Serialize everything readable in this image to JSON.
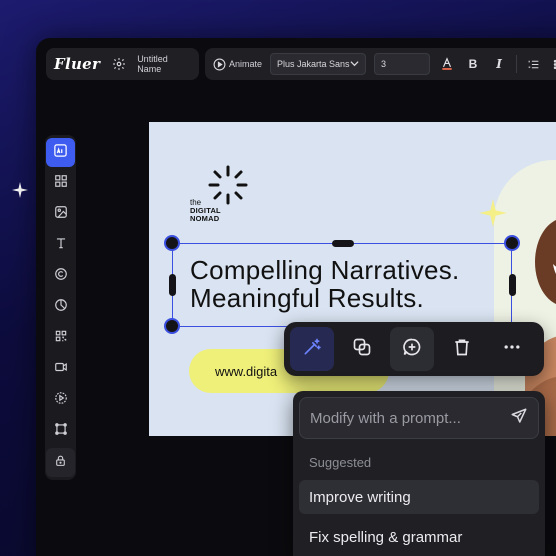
{
  "app": {
    "logo": "Fluer",
    "document_name": "Untitled Name",
    "animate_label": "Animate",
    "font_family": "Plus Jakarta Sans",
    "font_size": "3"
  },
  "toolbar_buttons": {
    "bold": "B",
    "italic": "I"
  },
  "sidebar": {
    "items": [
      {
        "icon": "ai-image-icon"
      },
      {
        "icon": "grid-icon"
      },
      {
        "icon": "image-icon"
      },
      {
        "icon": "text-icon"
      },
      {
        "icon": "copyright-icon"
      },
      {
        "icon": "chart-icon"
      },
      {
        "icon": "qr-code-icon"
      },
      {
        "icon": "video-icon"
      },
      {
        "icon": "audio-icon"
      },
      {
        "icon": "resize-icon"
      },
      {
        "icon": "lock-icon"
      }
    ]
  },
  "canvas": {
    "brand_the": "the",
    "brand_line1": "DIGITAL",
    "brand_line2": "NOMAD",
    "headline_line1": "Compelling Narratives.",
    "headline_line2": "Meaningful Results.",
    "url_text": "www.digita"
  },
  "floating_toolbar": {
    "buttons": [
      "magic-edit-icon",
      "duplicate-icon",
      "add-comment-icon",
      "delete-icon",
      "more-icon"
    ]
  },
  "prompt": {
    "placeholder": "Modify with a prompt...",
    "suggested_label": "Suggested",
    "suggestions": [
      "Improve writing",
      "Fix spelling & grammar"
    ]
  },
  "colors": {
    "accent": "#3f5cf0",
    "selection": "#3b4fe0",
    "pill": "#eff07a",
    "canvas_bg": "#d9e3f1"
  }
}
